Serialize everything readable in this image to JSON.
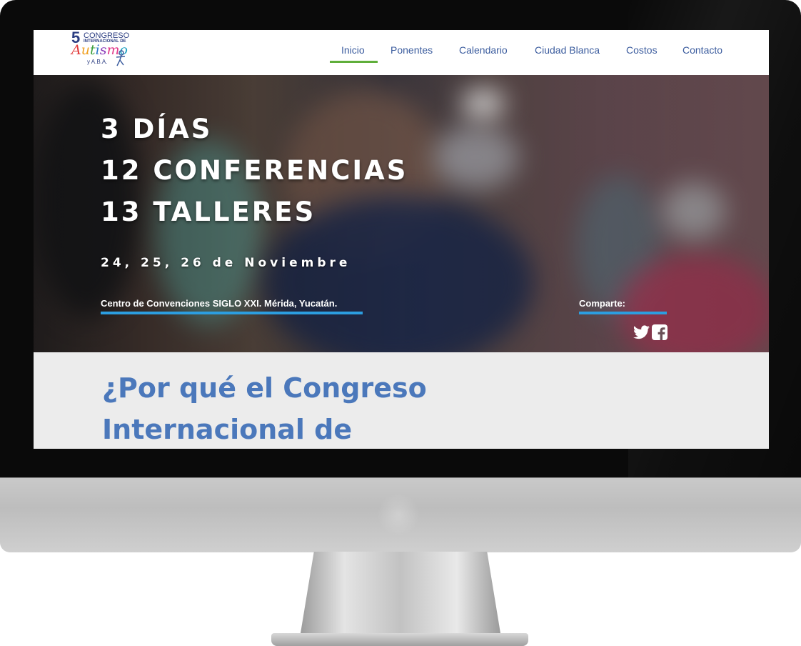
{
  "logo": {
    "number": "5",
    "line1": "CONGRESO",
    "line2": "INTERNACIONAL DE",
    "word": "Autismo",
    "line3": "y A.B.A."
  },
  "nav": {
    "items": [
      {
        "label": "Inicio",
        "active": true
      },
      {
        "label": "Ponentes"
      },
      {
        "label": "Calendario"
      },
      {
        "label": "Ciudad Blanca"
      },
      {
        "label": "Costos"
      },
      {
        "label": "Contacto"
      }
    ],
    "active_color": "#5fae3a",
    "link_color": "#3b5c9e"
  },
  "hero": {
    "line1": "3 DÍAS",
    "line2": "12 CONFERENCIAS",
    "line3": "13 TALLERES",
    "dates": "24, 25, 26 de Noviembre",
    "venue": "Centro de Convenciones SIGLO XXI. Mérida, Yucatán.",
    "share_label": "Comparte:",
    "accent_color": "#2c9ee0",
    "icons": [
      "twitter-icon",
      "facebook-icon"
    ]
  },
  "section": {
    "heading": "¿Por qué el Congreso Internacional de",
    "heading_color": "#4b78bb"
  }
}
